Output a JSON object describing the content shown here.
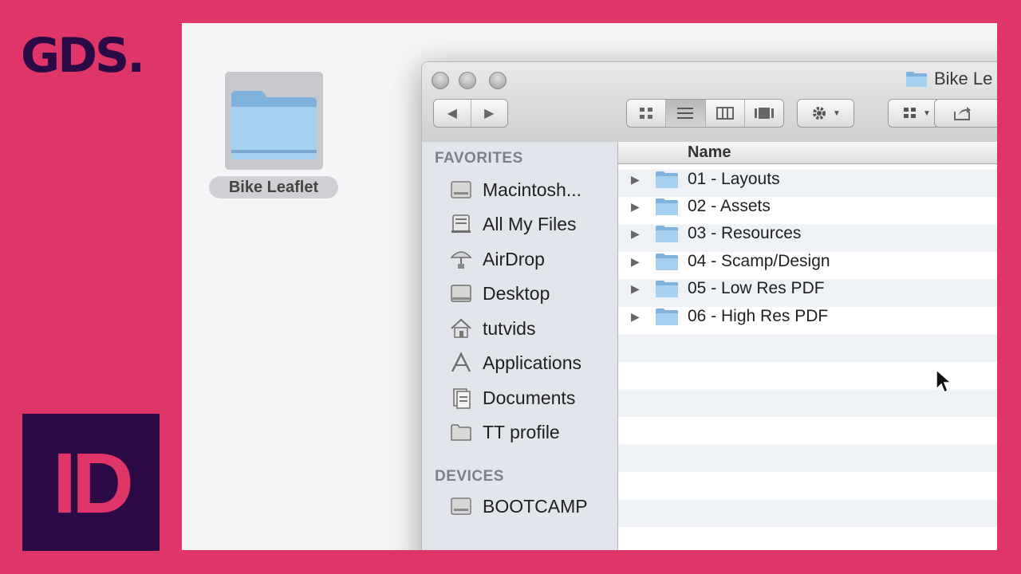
{
  "brand": {
    "text": "GDS."
  },
  "app_logo": {
    "text": "ID"
  },
  "desktop": {
    "folder_label": "Bike Leaflet"
  },
  "window": {
    "title": "Bike Le",
    "toolbar": {
      "back_icon": "back-arrow-icon",
      "forward_icon": "forward-arrow-icon",
      "view_icons": [
        "icon-view-icon",
        "list-view-icon",
        "column-view-icon",
        "coverflow-view-icon"
      ],
      "action_icon": "gear-icon",
      "arrange_icon": "arrange-icon",
      "share_icon": "share-icon"
    }
  },
  "sidebar": {
    "favorites_header": "FAVORITES",
    "favorites": [
      {
        "label": "Macintosh...",
        "icon": "hard-drive-icon"
      },
      {
        "label": "All My Files",
        "icon": "all-files-icon"
      },
      {
        "label": "AirDrop",
        "icon": "airdrop-icon"
      },
      {
        "label": "Desktop",
        "icon": "desktop-icon"
      },
      {
        "label": "tutvids",
        "icon": "home-icon"
      },
      {
        "label": "Applications",
        "icon": "applications-icon"
      },
      {
        "label": "Documents",
        "icon": "documents-icon"
      },
      {
        "label": "TT profile",
        "icon": "folder-icon"
      }
    ],
    "devices_header": "DEVICES",
    "devices": [
      {
        "label": "BOOTCAMP",
        "icon": "hard-drive-icon"
      }
    ]
  },
  "list": {
    "column_name": "Name",
    "rows": [
      {
        "name": "01 - Layouts"
      },
      {
        "name": "02 - Assets"
      },
      {
        "name": "03 - Resources"
      },
      {
        "name": "04 - Scamp/Design"
      },
      {
        "name": "05 - Low Res PDF"
      },
      {
        "name": "06 - High Res PDF"
      }
    ]
  },
  "colors": {
    "background": "#e03568",
    "brand_dark": "#2a0a45",
    "folder_blue": "#8fc0e8"
  }
}
